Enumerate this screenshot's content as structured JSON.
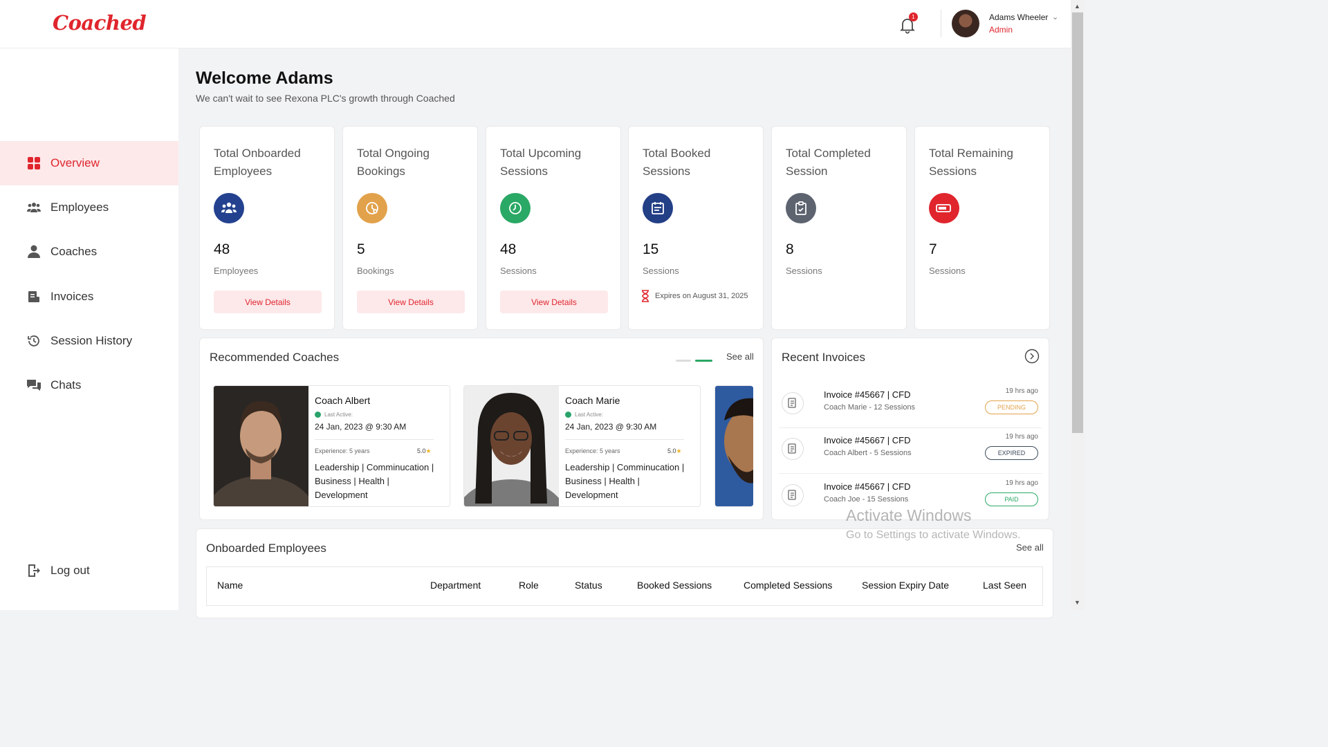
{
  "brand": {
    "logo_text": "Coached",
    "accent": "#e0252d"
  },
  "header": {
    "notification_count": "1",
    "user_name": "Adams Wheeler",
    "user_role": "Admin"
  },
  "sidebar": {
    "items": [
      {
        "label": "Overview",
        "icon": "grid-icon",
        "active": true
      },
      {
        "label": "Employees",
        "icon": "users-icon"
      },
      {
        "label": "Coaches",
        "icon": "person-icon"
      },
      {
        "label": "Invoices",
        "icon": "invoice-icon"
      },
      {
        "label": "Session History",
        "icon": "history-icon"
      },
      {
        "label": "Chats",
        "icon": "chat-icon"
      }
    ],
    "logout_label": "Log out"
  },
  "welcome": {
    "title": "Welcome Adams",
    "subtitle": "We can't wait to see Rexona PLC's growth through Coached"
  },
  "stats": [
    {
      "title": "Total Onboarded Employees",
      "value": "48",
      "unit": "Employees",
      "button": "View Details",
      "color": "#23418f"
    },
    {
      "title": "Total Ongoing Bookings",
      "value": "5",
      "unit": "Bookings",
      "button": "View Details",
      "color": "#e2a24b"
    },
    {
      "title": "Total Upcoming Sessions",
      "value": "48",
      "unit": "Sessions",
      "button": "View Details",
      "color": "#2aa865"
    },
    {
      "title": "Total Booked Sessions",
      "value": "15",
      "unit": "Sessions",
      "expiry": "Expires on August 31, 2025",
      "color": "#233f86"
    },
    {
      "title": "Total Completed Session",
      "value": "8",
      "unit": "Sessions",
      "color": "#5d6470"
    },
    {
      "title": "Total Remaining Sessions",
      "value": "7",
      "unit": "Sessions",
      "color": "#e0252d"
    }
  ],
  "recommended": {
    "title": "Recommended Coaches",
    "see_all": "See all",
    "coaches": [
      {
        "name": "Coach Albert",
        "last_active_label": "Last Active:",
        "date": "24 Jan, 2023 @ 9:30 AM",
        "experience": "Experience: 5 years",
        "rating": "5.0",
        "tags": "Leadership | Comminucation | Business | Health | Development"
      },
      {
        "name": "Coach Marie",
        "last_active_label": "Last Active:",
        "date": "24 Jan, 2023 @ 9:30 AM",
        "experience": "Experience: 5 years",
        "rating": "5.0",
        "tags": "Leadership | Comminucation | Business | Health | Development"
      }
    ]
  },
  "invoices": {
    "title": "Recent Invoices",
    "items": [
      {
        "title": "Invoice #45667 | CFD",
        "sub": "Coach Marie - 12 Sessions",
        "time": "19 hrs ago",
        "status": "PENDING",
        "status_color": "#e2a24b"
      },
      {
        "title": "Invoice #45667 | CFD",
        "sub": "Coach Albert - 5 Sessions",
        "time": "19 hrs ago",
        "status": "EXPIRED",
        "status_color": "#3b4a5a"
      },
      {
        "title": "Invoice #45667 | CFD",
        "sub": "Coach Joe - 15 Sessions",
        "time": "19 hrs ago",
        "status": "PAID",
        "status_color": "#2aa865"
      }
    ]
  },
  "watermark": {
    "line1": "Activate Windows",
    "line2": "Go to Settings to activate Windows."
  },
  "employees_table": {
    "title": "Onboarded Employees",
    "see_all": "See all",
    "columns": [
      "Name",
      "Department",
      "Role",
      "Status",
      "Booked Sessions",
      "Completed Sessions",
      "Session Expiry Date",
      "Last Seen"
    ]
  }
}
